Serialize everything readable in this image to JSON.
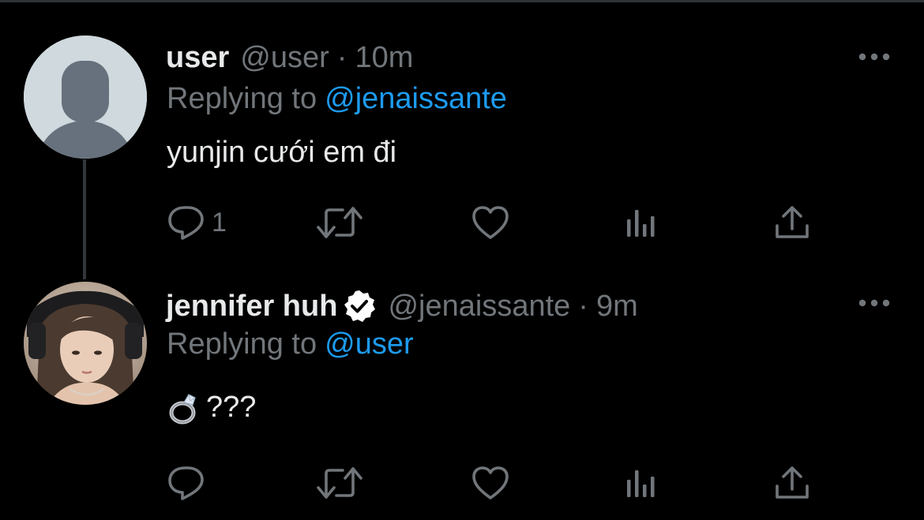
{
  "colors": {
    "background": "#000000",
    "text_primary": "#e7e9ea",
    "text_secondary": "#71767b",
    "accent": "#1d9bf0",
    "thread_line": "#333639"
  },
  "tweets": [
    {
      "display_name": "user",
      "handle": "@user",
      "separator": "·",
      "time": "10m",
      "replying_prefix": "Replying to",
      "replying_to": "@jenaissante",
      "text": "yunjin cưới em đi",
      "verified": false,
      "avatar": "default-avatar-icon",
      "actions": {
        "reply_count": "1",
        "reply_icon": "reply-icon",
        "retweet_icon": "retweet-icon",
        "like_icon": "heart-icon",
        "views_icon": "views-chart-icon",
        "share_icon": "share-icon"
      }
    },
    {
      "display_name": "jennifer huh",
      "handle": "@jenaissante",
      "separator": "·",
      "time": "9m",
      "replying_prefix": "Replying to",
      "replying_to": "@user",
      "text_emoji": "ring-icon",
      "text": "???",
      "verified": true,
      "avatar": "profile-photo",
      "actions": {
        "reply_icon": "reply-icon",
        "retweet_icon": "retweet-icon",
        "like_icon": "heart-icon",
        "views_icon": "views-chart-icon",
        "share_icon": "share-icon"
      }
    }
  ]
}
